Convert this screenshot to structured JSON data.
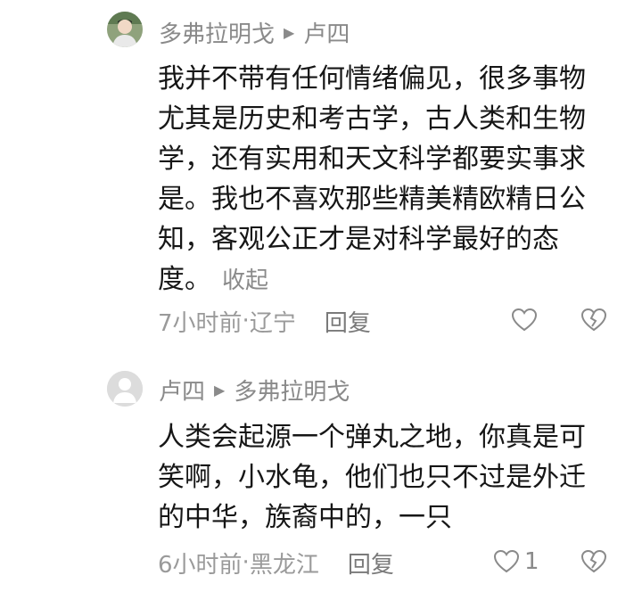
{
  "comments": [
    {
      "author": "多弗拉明戈",
      "reply_to": "卢四",
      "text": "我并不带有任何情绪偏见，很多事物尤其是历史和考古学，古人类和生物学，还有实用和天文科学都要实事求是。我也不喜欢那些精美精欧精日公知，客观公正才是对科学最好的态度。",
      "collapse_label": "收起",
      "time": "7小时前",
      "location": "辽宁",
      "reply_label": "回复",
      "like_count": ""
    },
    {
      "author": "卢四",
      "reply_to": "多弗拉明戈",
      "text": "人类会起源一个弹丸之地，你真是可笑啊，小水龟，他们也只不过是外迁的中华，族裔中的，一只",
      "time": "6小时前",
      "location": "黑龙江",
      "reply_label": "回复",
      "like_count": "1"
    }
  ],
  "separator": " · ",
  "colors": {
    "text": "#161616",
    "secondary": "#8a8a8a",
    "background": "#ffffff"
  }
}
